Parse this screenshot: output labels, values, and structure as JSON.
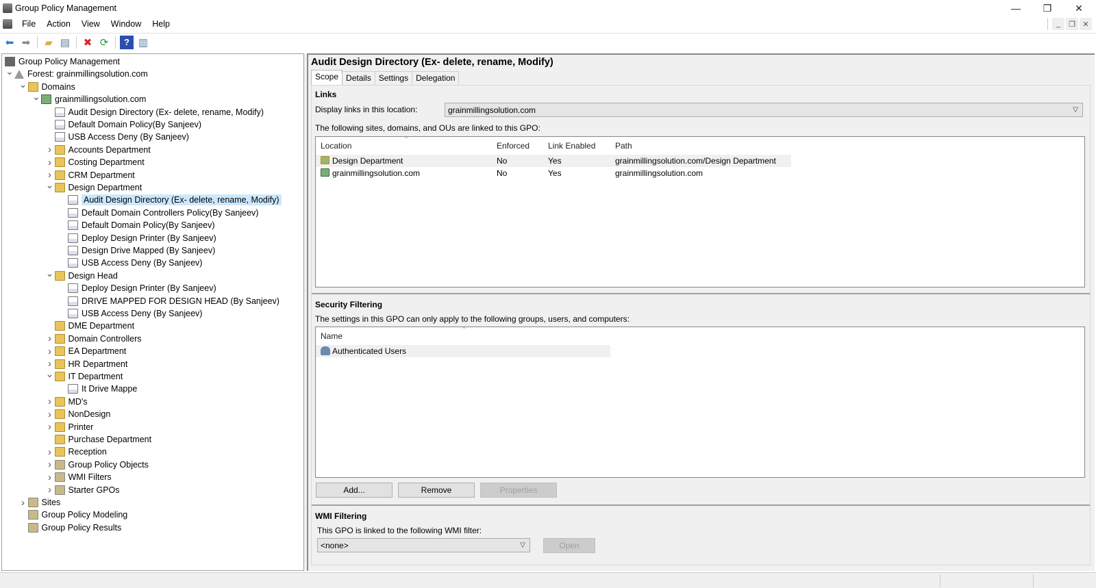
{
  "window": {
    "title": "Group Policy Management"
  },
  "menu": [
    "File",
    "Action",
    "View",
    "Window",
    "Help"
  ],
  "toolbar": [
    {
      "icon": "back-arrow-icon",
      "glyph": "⬅",
      "color": "#2b7bd0"
    },
    {
      "icon": "forward-arrow-icon",
      "glyph": "➡",
      "color": "#888888"
    },
    {
      "icon": "up-folder-icon",
      "glyph": "▰",
      "color": "#d9b23a"
    },
    {
      "icon": "show-hide-tree-icon",
      "glyph": "▤",
      "color": "#5a7f9a"
    },
    {
      "icon": "delete-icon",
      "glyph": "✖",
      "color": "#e02020"
    },
    {
      "icon": "refresh-icon",
      "glyph": "⟳",
      "color": "#2a9a3a"
    },
    {
      "icon": "help-icon",
      "glyph": "?",
      "color": "#2a4fb0"
    },
    {
      "icon": "show-action-pane-icon",
      "glyph": "▥",
      "color": "#5a7f9a"
    }
  ],
  "tree": [
    {
      "label": "Group Policy Management",
      "level": 0,
      "type": "gpm",
      "chev": ""
    },
    {
      "label": "Forest: grainmillingsolution.com",
      "level": 0,
      "type": "forest",
      "chev": "v"
    },
    {
      "label": "Domains",
      "level": 1,
      "type": "folder",
      "chev": "v"
    },
    {
      "label": "grainmillingsolution.com",
      "level": 2,
      "type": "domain",
      "chev": "v"
    },
    {
      "label": "Audit Design Directory (Ex- delete, rename, Modify)",
      "level": 3,
      "type": "gpo",
      "chev": ""
    },
    {
      "label": "Default Domain Policy(By Sanjeev)",
      "level": 3,
      "type": "gpo",
      "chev": ""
    },
    {
      "label": "USB Access Deny (By Sanjeev)",
      "level": 3,
      "type": "gpo",
      "chev": ""
    },
    {
      "label": "Accounts Department",
      "level": 3,
      "type": "folder",
      "chev": ">"
    },
    {
      "label": "Costing Department",
      "level": 3,
      "type": "folder",
      "chev": ">"
    },
    {
      "label": "CRM Department",
      "level": 3,
      "type": "folder",
      "chev": ">"
    },
    {
      "label": "Design Department",
      "level": 3,
      "type": "folder",
      "chev": "v"
    },
    {
      "label": "Audit Design Directory (Ex- delete, rename, Modify)",
      "level": 4,
      "type": "gpo",
      "chev": "",
      "selected": true
    },
    {
      "label": "Default Domain Controllers Policy(By Sanjeev)",
      "level": 4,
      "type": "gpo",
      "chev": ""
    },
    {
      "label": "Default Domain Policy(By Sanjeev)",
      "level": 4,
      "type": "gpo",
      "chev": ""
    },
    {
      "label": "Deploy Design Printer (By Sanjeev)",
      "level": 4,
      "type": "gpo",
      "chev": ""
    },
    {
      "label": "Design Drive Mapped (By Sanjeev)",
      "level": 4,
      "type": "gpo",
      "chev": ""
    },
    {
      "label": "USB Access Deny (By Sanjeev)",
      "level": 4,
      "type": "gpo",
      "chev": ""
    },
    {
      "label": "Design Head",
      "level": 3,
      "type": "folder",
      "chev": "v"
    },
    {
      "label": "Deploy Design Printer (By Sanjeev)",
      "level": 4,
      "type": "gpo",
      "chev": ""
    },
    {
      "label": "DRIVE MAPPED FOR DESIGN HEAD (By Sanjeev)",
      "level": 4,
      "type": "gpo",
      "chev": ""
    },
    {
      "label": "USB Access Deny (By Sanjeev)",
      "level": 4,
      "type": "gpo",
      "chev": ""
    },
    {
      "label": "DME Department",
      "level": 3,
      "type": "folder",
      "chev": ""
    },
    {
      "label": "Domain Controllers",
      "level": 3,
      "type": "folder",
      "chev": ">"
    },
    {
      "label": "EA Department",
      "level": 3,
      "type": "folder",
      "chev": ">"
    },
    {
      "label": "HR Department",
      "level": 3,
      "type": "folder",
      "chev": ">"
    },
    {
      "label": "IT Department",
      "level": 3,
      "type": "folder",
      "chev": "v"
    },
    {
      "label": "It Drive Mappe",
      "level": 4,
      "type": "gpo",
      "chev": ""
    },
    {
      "label": "MD's",
      "level": 3,
      "type": "folder",
      "chev": ">"
    },
    {
      "label": "NonDesign",
      "level": 3,
      "type": "folder",
      "chev": ">"
    },
    {
      "label": "Printer",
      "level": 3,
      "type": "folder",
      "chev": ">"
    },
    {
      "label": "Purchase Department",
      "level": 3,
      "type": "folder",
      "chev": ""
    },
    {
      "label": "Reception",
      "level": 3,
      "type": "folder",
      "chev": ">"
    },
    {
      "label": "Group Policy Objects",
      "level": 3,
      "type": "other",
      "chev": ">"
    },
    {
      "label": "WMI Filters",
      "level": 3,
      "type": "other",
      "chev": ">"
    },
    {
      "label": "Starter GPOs",
      "level": 3,
      "type": "other",
      "chev": ">"
    },
    {
      "label": "Sites",
      "level": 1,
      "type": "other",
      "chev": ">"
    },
    {
      "label": "Group Policy Modeling",
      "level": 1,
      "type": "other",
      "chev": ""
    },
    {
      "label": "Group Policy Results",
      "level": 1,
      "type": "other",
      "chev": ""
    }
  ],
  "details": {
    "title": "Audit Design Directory (Ex- delete, rename, Modify)",
    "tabs": [
      "Scope",
      "Details",
      "Settings",
      "Delegation"
    ],
    "links": {
      "heading": "Links",
      "location_label": "Display links in this location:",
      "location_value": "grainmillingsolution.com",
      "list_caption": "The following sites, domains, and OUs are linked to this GPO:",
      "columns": [
        "Location",
        "Enforced",
        "Link Enabled",
        "Path"
      ],
      "rows": [
        {
          "location": "Design Department",
          "enforced": "No",
          "enabled": "Yes",
          "path": "grainmillingsolution.com/Design Department"
        },
        {
          "location": "grainmillingsolution.com",
          "enforced": "No",
          "enabled": "Yes",
          "path": "grainmillingsolution.com"
        }
      ]
    },
    "security": {
      "heading": "Security Filtering",
      "caption": "The settings in this GPO can only apply to the following groups, users, and computers:",
      "columns": [
        "Name"
      ],
      "rows": [
        "Authenticated Users"
      ],
      "buttons": {
        "add": "Add...",
        "remove": "Remove",
        "properties": "Properties"
      }
    },
    "wmi": {
      "heading": "WMI Filtering",
      "caption": "This GPO is linked to the following WMI filter:",
      "value": "<none>",
      "open": "Open"
    }
  }
}
